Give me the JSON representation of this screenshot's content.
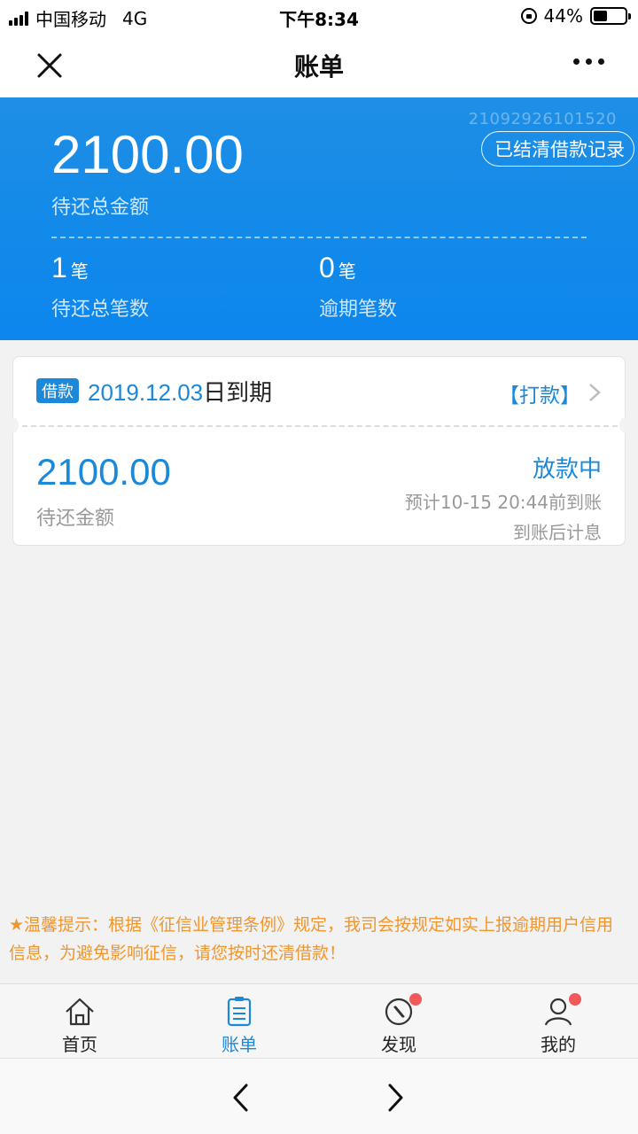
{
  "status_bar": {
    "carrier": "中国移动",
    "network": "4G",
    "time": "下午8:34",
    "battery": "44%",
    "battery_level": 0.44
  },
  "nav": {
    "title": "账单"
  },
  "summary": {
    "order_id": "21092926101520",
    "settled_button": "已结清借款记录",
    "total_amount": "2100.00",
    "total_label": "待还总金额",
    "count_value": "1",
    "count_unit": "笔",
    "count_label": "待还总笔数",
    "overdue_value": "0",
    "overdue_unit": "笔",
    "overdue_label": "逾期笔数"
  },
  "bill": {
    "tag": "借款",
    "due_date": "2019.12.03",
    "due_suffix": "日到期",
    "pay_link": "【打款】",
    "amount": "2100.00",
    "amount_label": "待还金额",
    "status": "放款中",
    "eta": "预计10-15 20:44前到账",
    "interest_note": "到账后计息"
  },
  "notice": {
    "text": "★温馨提示：根据《征信业管理条例》规定，我司会按规定如实上报逾期用户信用信息，为避免影响征信，请您按时还清借款！"
  },
  "tabs": [
    {
      "label": "首页",
      "icon": "home-icon"
    },
    {
      "label": "账单",
      "icon": "bill-icon"
    },
    {
      "label": "发现",
      "icon": "compass-icon"
    },
    {
      "label": "我的",
      "icon": "user-icon"
    }
  ],
  "colors": {
    "primary_blue": "#1c88d8",
    "summary_blue": "#148be8",
    "notice_orange": "#f0962e",
    "badge_red": "#f25a5a"
  }
}
